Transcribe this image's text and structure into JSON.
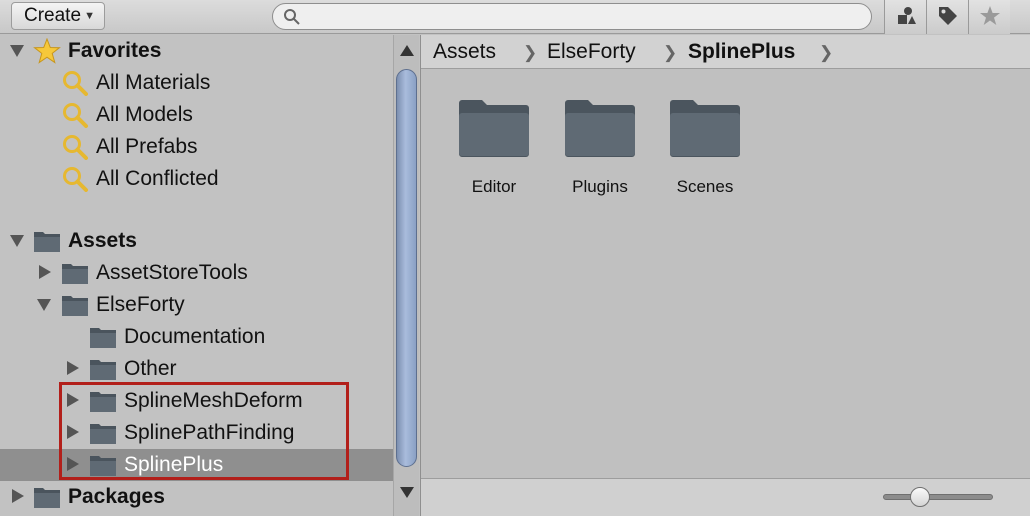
{
  "toolbar": {
    "create_label": "Create",
    "search_placeholder": "",
    "buttons": [
      "filter-by-type-icon",
      "tag-icon",
      "star-icon"
    ]
  },
  "tree": {
    "favorites": {
      "label": "Favorites",
      "items": [
        "All Materials",
        "All Models",
        "All Prefabs",
        "All Conflicted"
      ]
    },
    "assets": {
      "label": "Assets",
      "children": {
        "asset_store_tools": "AssetStoreTools",
        "else_forty": "ElseForty",
        "documentation": "Documentation",
        "other": "Other",
        "spline_mesh_deform": "SplineMeshDeform",
        "spline_path_finding": "SplinePathFinding",
        "spline_plus": "SplinePlus"
      }
    },
    "packages": {
      "label": "Packages"
    },
    "selected": "SplinePlus"
  },
  "breadcrumb": [
    "Assets",
    "ElseForty",
    "SplinePlus"
  ],
  "folders": [
    "Editor",
    "Plugins",
    "Scenes"
  ],
  "colors": {
    "highlight": "#b21f1a",
    "selection": "#8f8f8f",
    "folder": "#5b6670",
    "scrollbar_thumb": "#9aaed0"
  }
}
